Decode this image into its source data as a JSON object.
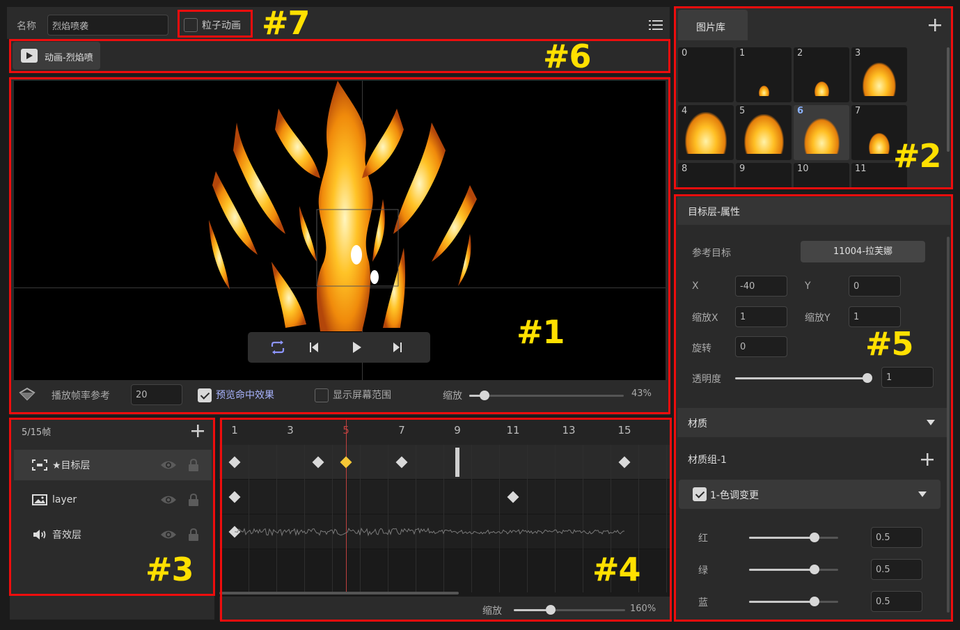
{
  "header": {
    "name_label": "名称",
    "name_value": "烈焰喷袭",
    "particle_label": "粒子动画"
  },
  "tab_bar": {
    "anim_label": "动画-烈焰喷"
  },
  "preview": {
    "fps_label": "播放帧率参考",
    "fps_value": "20",
    "hit_effect_label": "预览命中效果",
    "screen_range_label": "显示屏幕范围",
    "zoom_label": "缩放",
    "zoom_value": "43%",
    "zoom_fraction": 0.1,
    "controls": [
      "loop-icon",
      "prev-frame-icon",
      "play-icon",
      "next-frame-icon"
    ]
  },
  "gallery": {
    "tab_label": "图片库",
    "items": [
      "0",
      "1",
      "2",
      "3",
      "4",
      "5",
      "6",
      "7",
      "8",
      "9",
      "10",
      "11"
    ],
    "selected": "6"
  },
  "layers": {
    "frame_counter": "5/15帧",
    "items": [
      {
        "label": "★目标层",
        "icon": "target-icon"
      },
      {
        "label": "layer",
        "icon": "image-icon"
      },
      {
        "label": "音效层",
        "icon": "speaker-icon"
      }
    ]
  },
  "timeline": {
    "ticks": [
      "1",
      "3",
      "5",
      "7",
      "9",
      "11",
      "13",
      "15"
    ],
    "current": "5",
    "zoom_label": "缩放",
    "zoom_value": "160%",
    "zoom_fraction": 0.33
  },
  "properties": {
    "title": "目标层-属性",
    "ref_label": "参考目标",
    "ref_value": "11004-拉芙娜",
    "x_label": "X",
    "x_value": "-40",
    "y_label": "Y",
    "y_value": "0",
    "scale_x_label": "缩放X",
    "scale_x_value": "1",
    "scale_y_label": "缩放Y",
    "scale_y_value": "1",
    "rotation_label": "旋转",
    "rotation_value": "0",
    "opacity_label": "透明度",
    "opacity_value": "1",
    "opacity_fraction": 1.0,
    "material_label": "材质",
    "material_group_label": "材质组-1",
    "hue_label": "1-色调变更",
    "red_label": "红",
    "red_value": "0.5",
    "green_label": "绿",
    "green_value": "0.5",
    "blue_label": "蓝",
    "blue_value": "0.5"
  },
  "markers": {
    "m1": "#1",
    "m2": "#2",
    "m3": "#3",
    "m4": "#4",
    "m5": "#5",
    "m6": "#6",
    "m7": "#7"
  },
  "colors": {
    "highlight_box": "#ee0d0d",
    "marker_text": "#ffe000",
    "active_keyframe": "#f6c736",
    "current_frame_line": "#c0413f"
  }
}
